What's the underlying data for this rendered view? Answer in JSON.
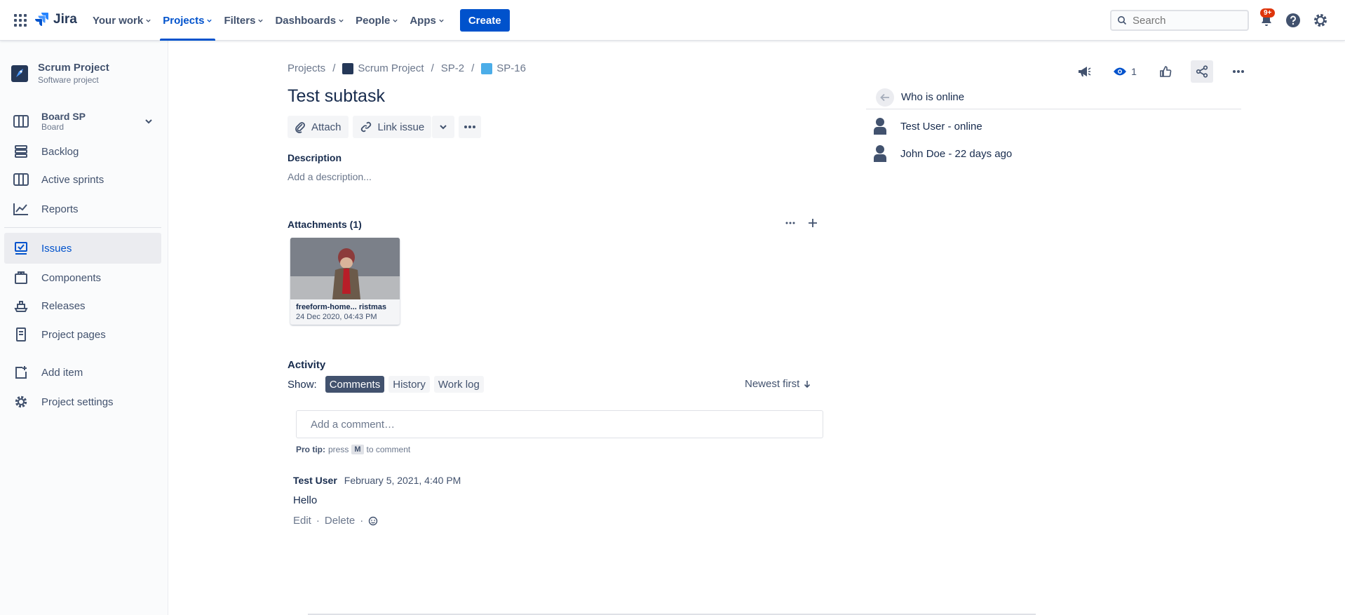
{
  "topbar": {
    "app_name": "Jira",
    "nav": [
      "Your work",
      "Projects",
      "Filters",
      "Dashboards",
      "People",
      "Apps"
    ],
    "active_nav": "Projects",
    "create_label": "Create",
    "search_placeholder": "Search",
    "notifications_badge": "9+"
  },
  "sidebar": {
    "project_name": "Scrum Project",
    "project_type": "Software project",
    "board_name": "Board SP",
    "board_type": "Board",
    "items": [
      {
        "label": "Backlog",
        "icon": "backlog-icon"
      },
      {
        "label": "Active sprints",
        "icon": "board-icon"
      },
      {
        "label": "Reports",
        "icon": "reports-icon"
      },
      {
        "label": "Issues",
        "icon": "issues-icon"
      },
      {
        "label": "Components",
        "icon": "components-icon"
      },
      {
        "label": "Releases",
        "icon": "releases-icon"
      },
      {
        "label": "Project pages",
        "icon": "pages-icon"
      },
      {
        "label": "Add item",
        "icon": "add-item-icon"
      },
      {
        "label": "Project settings",
        "icon": "gear-icon"
      }
    ],
    "selected": "Issues"
  },
  "issue": {
    "breadcrumbs": [
      "Projects",
      "Scrum Project",
      "SP-2",
      "SP-16"
    ],
    "title": "Test subtask",
    "attach_label": "Attach",
    "link_issue_label": "Link issue",
    "description_heading": "Description",
    "description_placeholder": "Add a description...",
    "attachments_heading": "Attachments (1)",
    "attachment": {
      "name": "freeform-home... ristmas",
      "date": "24 Dec 2020, 04:43 PM"
    },
    "watch_count": "1"
  },
  "activity": {
    "heading": "Activity",
    "show_label": "Show:",
    "filters": [
      "Comments",
      "History",
      "Work log"
    ],
    "selected_filter": "Comments",
    "sort_label": "Newest first",
    "comment_placeholder": "Add a comment…",
    "protip_bold": "Pro tip:",
    "protip_press": "press",
    "protip_key": "M",
    "protip_after": "to comment",
    "comments": [
      {
        "author": "Test User",
        "time": "February 5, 2021, 4:40 PM",
        "body": "Hello",
        "edit": "Edit",
        "delete": "Delete"
      }
    ]
  },
  "online_panel": {
    "title": "Who is online",
    "users": [
      "Test User - online",
      "John Doe - 22 days ago"
    ]
  },
  "colors": {
    "brand": "#0052cc",
    "text": "#172b4d",
    "subtle": "#6b778c",
    "badge": "#de350b"
  }
}
